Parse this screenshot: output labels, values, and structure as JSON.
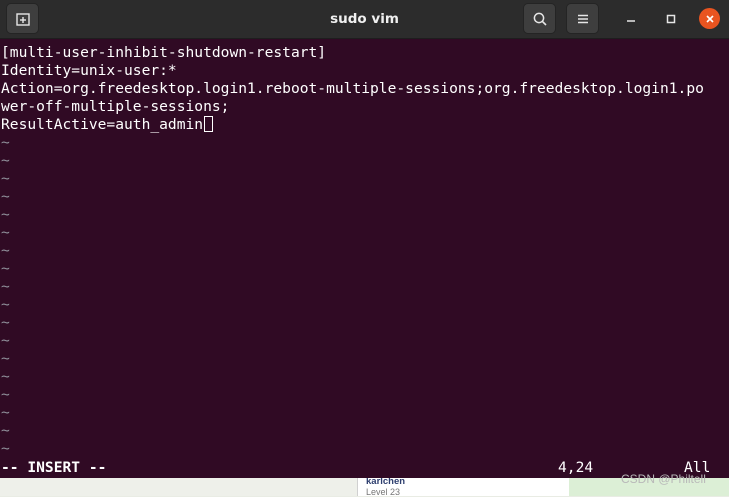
{
  "window": {
    "title": "sudo vim"
  },
  "editor": {
    "lines": [
      "[multi-user-inhibit-shutdown-restart]",
      "Identity=unix-user:*",
      "Action=org.freedesktop.login1.reboot-multiple-sessions;org.freedesktop.login1.po",
      "wer-off-multiple-sessions;",
      "ResultActive=auth_admin"
    ],
    "empty_line_marker": "~",
    "status": {
      "mode": "-- INSERT --",
      "position": "4,24",
      "scroll": "All"
    }
  },
  "background": {
    "user_name": "karlchen",
    "user_level": "Level 23",
    "watermark": "CSDN @Philtell"
  },
  "colors": {
    "terminal_bg": "#300a24",
    "titlebar_bg": "#2c2c2c",
    "close_button": "#e95420"
  },
  "icons": {
    "new_tab": "new-tab-icon",
    "search": "search-icon",
    "menu": "hamburger-menu-icon",
    "minimize": "minimize-icon",
    "maximize": "maximize-icon",
    "close": "close-icon"
  }
}
